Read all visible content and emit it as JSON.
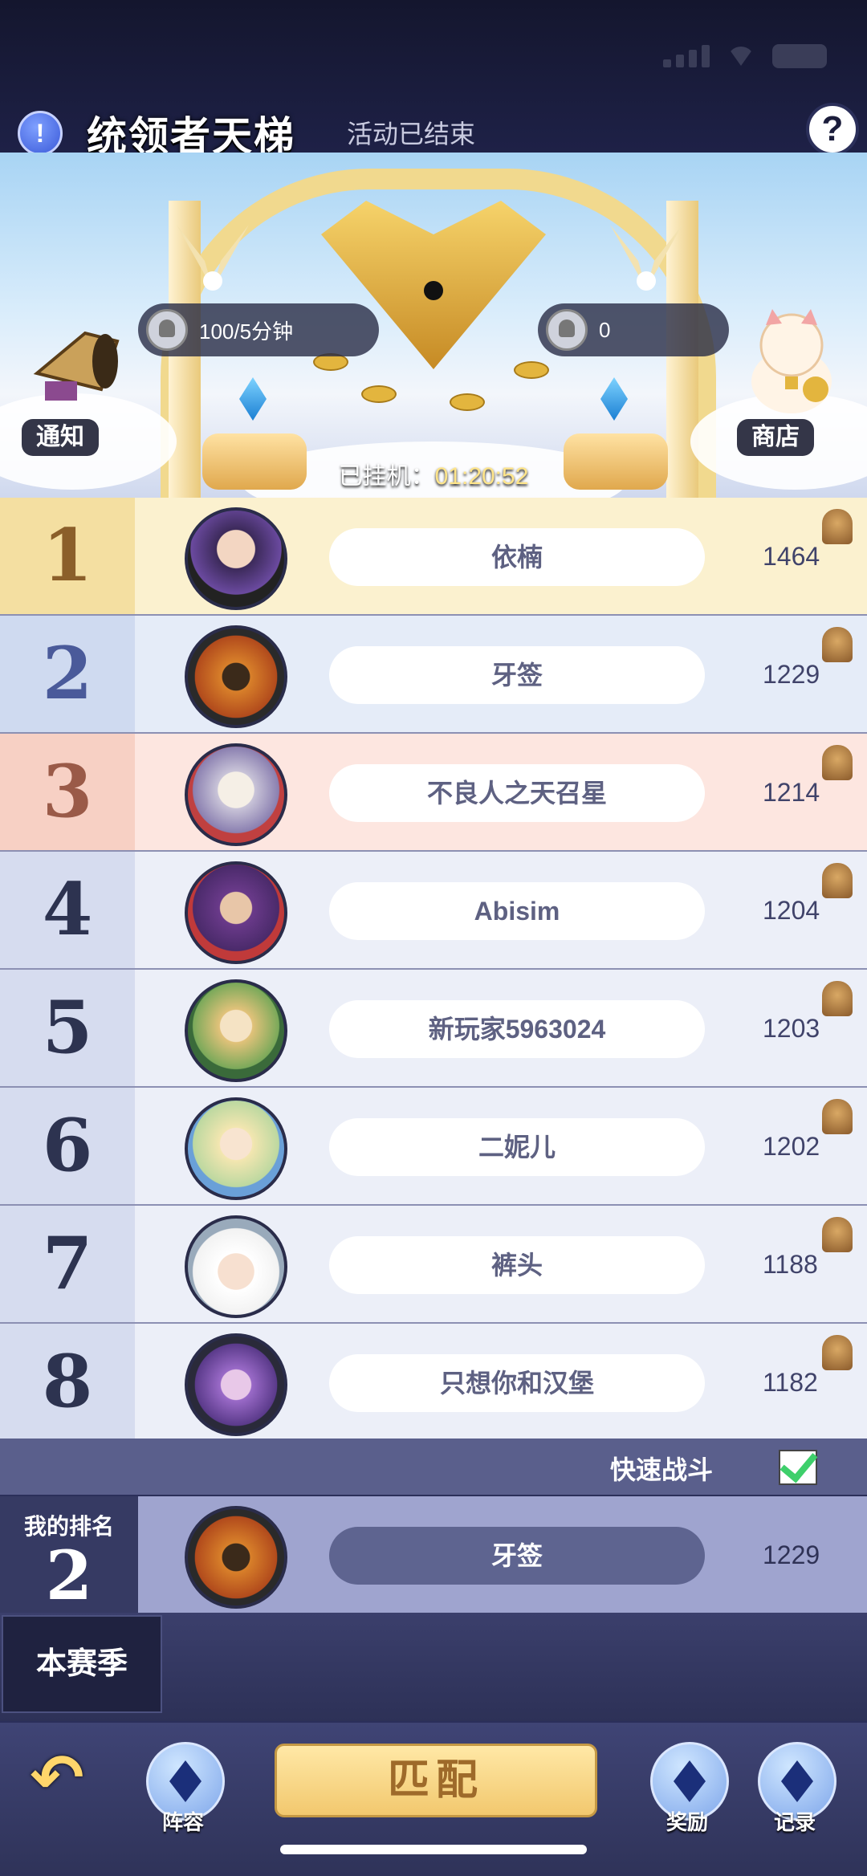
{
  "header": {
    "title": "统领者天梯",
    "subtitle": "活动已结束"
  },
  "banner": {
    "left_stat": "100/5分钟",
    "right_stat": "0",
    "notice_label": "通知",
    "shop_label": "商店",
    "idle_prefix": "已挂机：",
    "idle_time": "01:20:52"
  },
  "ranking": [
    {
      "rank": "1",
      "name": "依楠",
      "score": "1464"
    },
    {
      "rank": "2",
      "name": "牙签",
      "score": "1229"
    },
    {
      "rank": "3",
      "name": "不良人之天召星",
      "score": "1214"
    },
    {
      "rank": "4",
      "name": "Abisim",
      "score": "1204"
    },
    {
      "rank": "5",
      "name": "新玩家5963024",
      "score": "1203"
    },
    {
      "rank": "6",
      "name": "二妮儿",
      "score": "1202"
    },
    {
      "rank": "7",
      "name": "裤头",
      "score": "1188"
    },
    {
      "rank": "8",
      "name": "只想你和汉堡",
      "score": "1182"
    }
  ],
  "quick_battle": {
    "label": "快速战斗",
    "checked": true
  },
  "my_rank": {
    "label": "我的排名",
    "rank": "2",
    "name": "牙签",
    "score": "1229"
  },
  "season_button": "本赛季",
  "bottom_bar": {
    "lineup_label": "阵容",
    "match_label": "匹配",
    "reward_label": "奖励",
    "record_label": "记录"
  },
  "colors": {
    "rank1_bg": "#fbf1cf",
    "rank2_bg": "#e5ecf8",
    "rank3_bg": "#fde6e0",
    "rank_default_bg": "#eceff8"
  }
}
